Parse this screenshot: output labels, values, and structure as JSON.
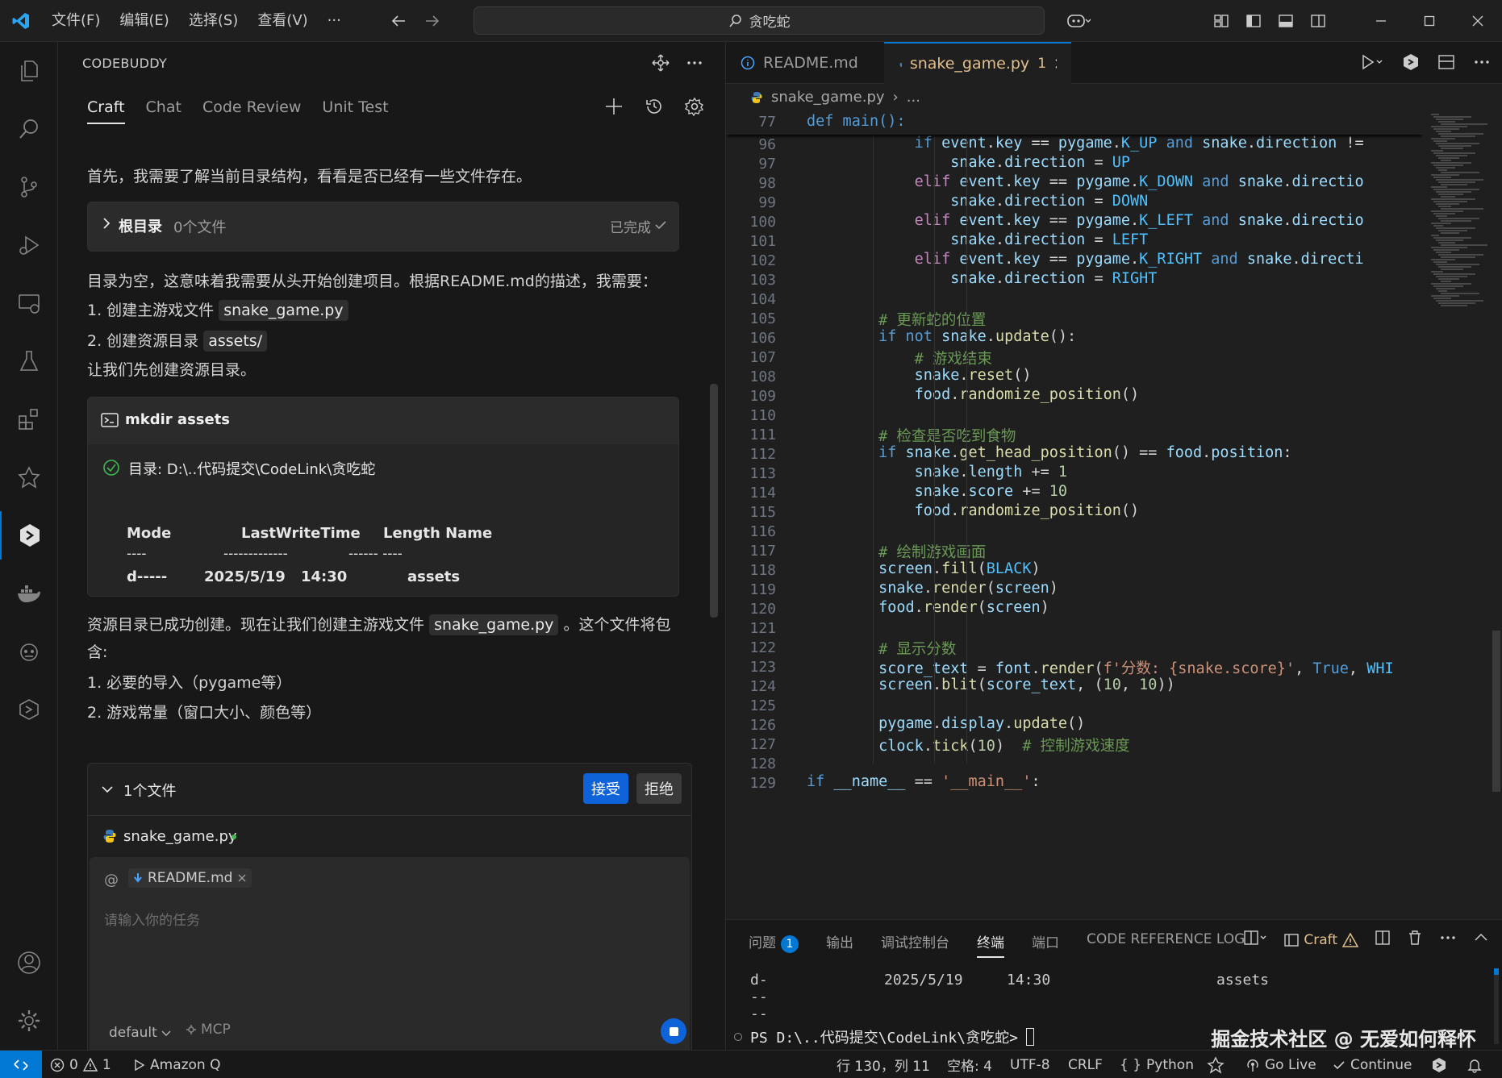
{
  "titlebar": {
    "menus": [
      "文件(F)",
      "编辑(E)",
      "选择(S)",
      "查看(V)",
      "···"
    ],
    "search": "贪吃蛇"
  },
  "sidebar": {
    "title": "CODEBUDDY",
    "tabs": [
      "Craft",
      "Chat",
      "Code Review",
      "Unit Test"
    ],
    "msg1": "首先，我需要了解当前目录结构，看看是否已经有一些文件存在。",
    "dir_card": {
      "label": "根目录",
      "count": "0个文件",
      "status": "已完成"
    },
    "msg2": "目录为空，这意味着我需要从头开始创建项目。根据README.md的描述，我需要：",
    "step1_prefix": "1. 创建主游戏文件",
    "step1_chip": "snake_game.py",
    "step2_prefix": "2. 创建资源目录",
    "step2_chip": "assets/",
    "msg3": "让我们先创建资源目录。",
    "cmd_card": {
      "title": "mkdir assets",
      "result": "目录: D:\\..代码提交\\CodeLink\\贪吃蛇",
      "headers": [
        "Mode",
        "LastWriteTime",
        "Length Name"
      ],
      "dashes": [
        "----",
        "-------------",
        "------ ----"
      ],
      "row": [
        "d-----",
        "2025/5/19",
        "14:30",
        "assets"
      ]
    },
    "msg4_a": "资源目录已成功创建。现在让我们创建主游戏文件",
    "msg4_chip": "snake_game.py",
    "msg4_b": "。这个文件将包",
    "msg4_c": "含:",
    "msg5": "1. 必要的导入（pygame等）",
    "msg6": "2. 游戏常量（窗口大小、颜色等）",
    "files_card": {
      "label": "1个文件",
      "accept": "接受",
      "reject": "拒绝",
      "file": "snake_game.py"
    },
    "input": {
      "at": "@",
      "context_file": "README.md",
      "placeholder": "请输入你的任务",
      "mode": "default",
      "mcp": "MCP"
    }
  },
  "editor": {
    "tabs": [
      {
        "name": "README.md"
      },
      {
        "name": "snake_game.py",
        "badge": "1"
      }
    ],
    "breadcrumb_file": "snake_game.py",
    "breadcrumb_more": "...",
    "sticky_line": "77",
    "sticky_text": "def main():",
    "lines": [
      {
        "n": "96",
        "t": "            if event.key == pygame.K_UP and snake.direction !="
      },
      {
        "n": "97",
        "t": "                snake.direction = UP"
      },
      {
        "n": "98",
        "t": "            elif event.key == pygame.K_DOWN and snake.directio"
      },
      {
        "n": "99",
        "t": "                snake.direction = DOWN"
      },
      {
        "n": "100",
        "t": "            elif event.key == pygame.K_LEFT and snake.directio"
      },
      {
        "n": "101",
        "t": "                snake.direction = LEFT"
      },
      {
        "n": "102",
        "t": "            elif event.key == pygame.K_RIGHT and snake.directi"
      },
      {
        "n": "103",
        "t": "                snake.direction = RIGHT"
      },
      {
        "n": "104",
        "t": ""
      },
      {
        "n": "105",
        "t": "        # 更新蛇的位置"
      },
      {
        "n": "106",
        "t": "        if not snake.update():"
      },
      {
        "n": "107",
        "t": "            # 游戏结束"
      },
      {
        "n": "108",
        "t": "            snake.reset()"
      },
      {
        "n": "109",
        "t": "            food.randomize_position()"
      },
      {
        "n": "110",
        "t": ""
      },
      {
        "n": "111",
        "t": "        # 检查是否吃到食物"
      },
      {
        "n": "112",
        "t": "        if snake.get_head_position() == food.position:"
      },
      {
        "n": "113",
        "t": "            snake.length += 1"
      },
      {
        "n": "114",
        "t": "            snake.score += 10"
      },
      {
        "n": "115",
        "t": "            food.randomize_position()"
      },
      {
        "n": "116",
        "t": ""
      },
      {
        "n": "117",
        "t": "        # 绘制游戏画面"
      },
      {
        "n": "118",
        "t": "        screen.fill(BLACK)"
      },
      {
        "n": "119",
        "t": "        snake.render(screen)"
      },
      {
        "n": "120",
        "t": "        food.render(screen)"
      },
      {
        "n": "121",
        "t": ""
      },
      {
        "n": "122",
        "t": "        # 显示分数"
      },
      {
        "n": "123",
        "t": "        score_text = font.render(f'分数: {snake.score}', True, WHI"
      },
      {
        "n": "124",
        "t": "        screen.blit(score_text, (10, 10))"
      },
      {
        "n": "125",
        "t": ""
      },
      {
        "n": "126",
        "t": "        pygame.display.update()"
      },
      {
        "n": "127",
        "t": "        clock.tick(10)  # 控制游戏速度"
      },
      {
        "n": "128",
        "t": ""
      },
      {
        "n": "129",
        "t": "if __name__ == '__main__':"
      }
    ]
  },
  "panel": {
    "tabs": [
      "问题",
      "输出",
      "调试控制台",
      "终端",
      "端口",
      "CODE REFERENCE LOG"
    ],
    "problems_count": "1",
    "craft_label": "Craft",
    "term_line1": [
      "d-----",
      "2025/5/19",
      "14:30",
      "assets"
    ],
    "prompt": "PS D:\\..代码提交\\CodeLink\\贪吃蛇>",
    "watermark": "掘金技术社区 @ 无爱如何释怀"
  },
  "statusbar": {
    "errors": "0",
    "warnings": "1",
    "amazonq": "Amazon Q",
    "position": "行 130，列 11",
    "spaces": "空格: 4",
    "encoding": "UTF-8",
    "eol": "CRLF",
    "language": "Python",
    "golive": "Go Live",
    "continue": "Continue"
  },
  "colors": {
    "accent": "#0078d4",
    "primary_button": "#0e63d9",
    "modified_tab": "#e2c08d"
  }
}
